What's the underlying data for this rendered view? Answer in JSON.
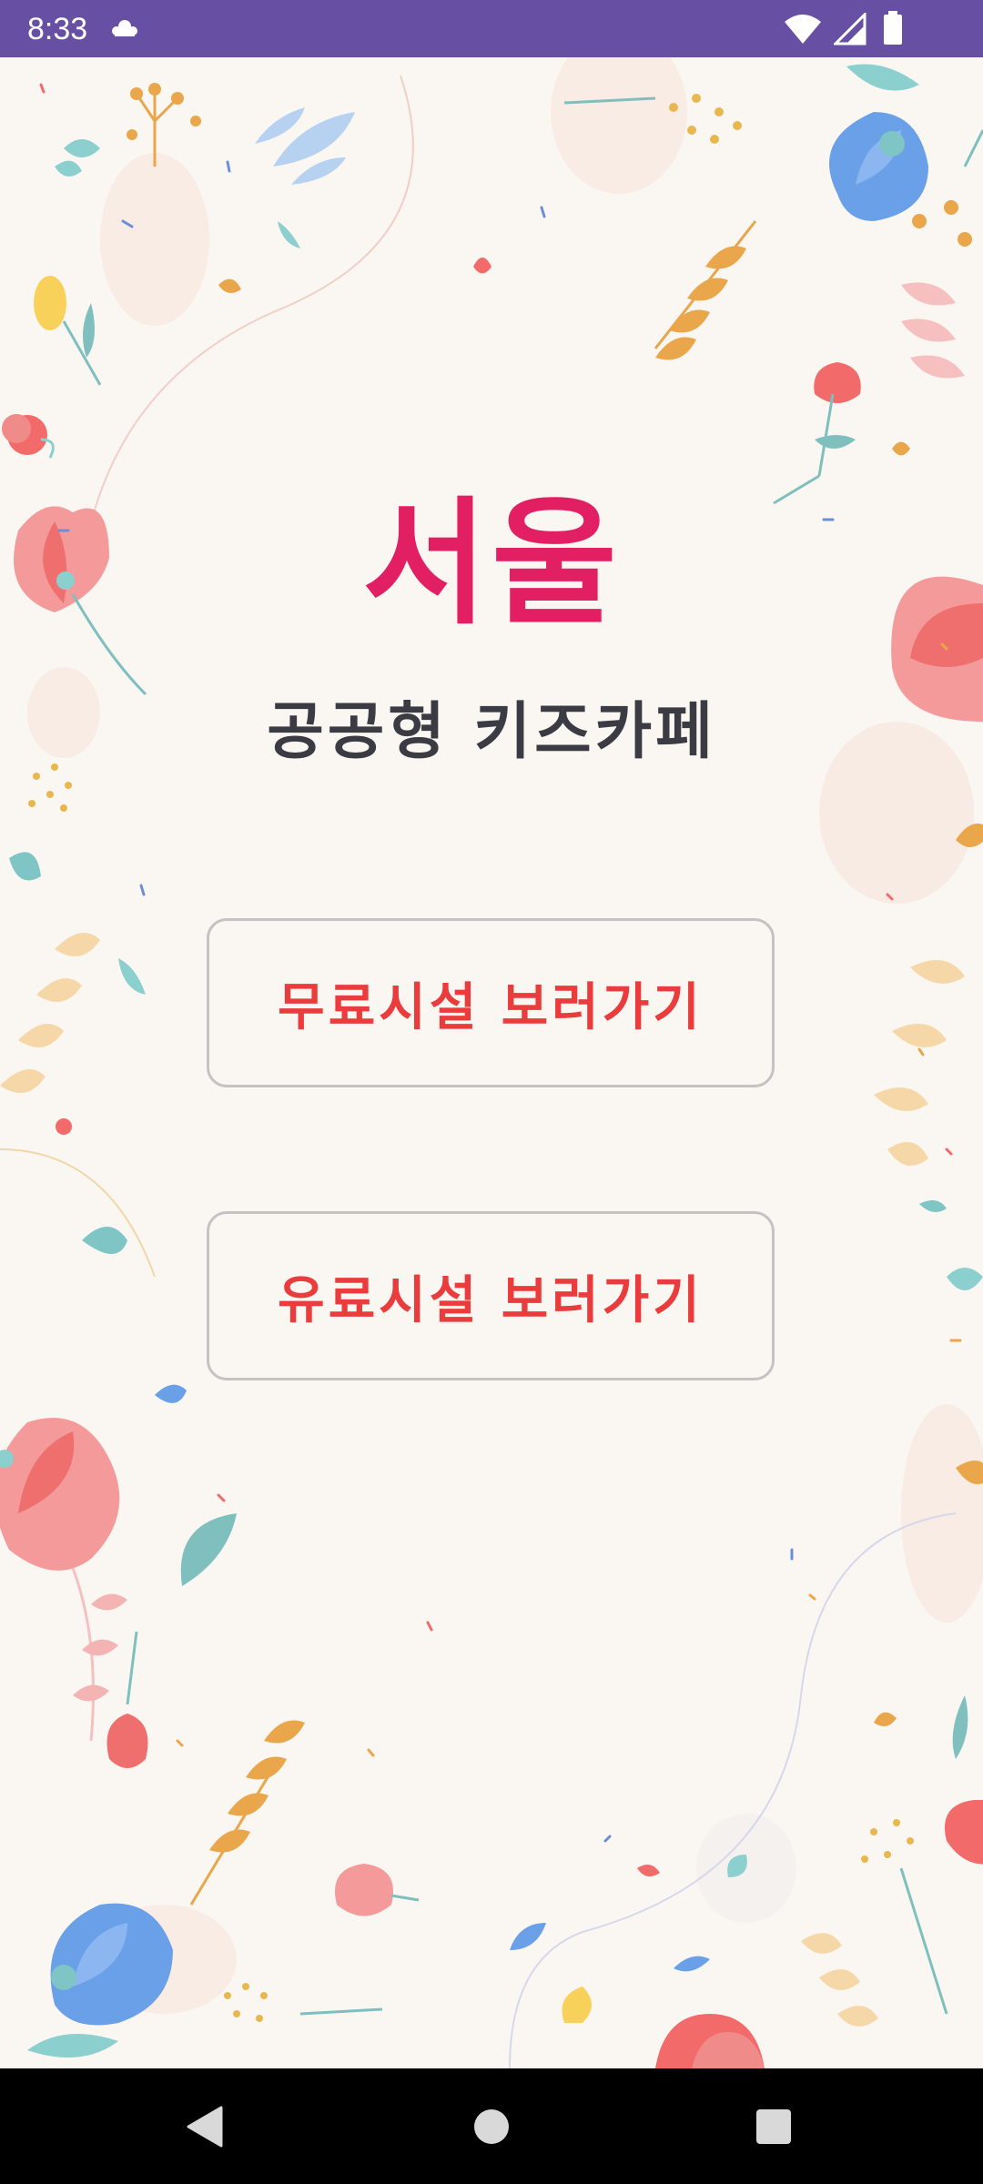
{
  "status_bar": {
    "time": "8:33",
    "notification_icon": "cloud-notification-icon",
    "wifi_icon": "wifi-icon",
    "signal_icon": "cell-signal-icon",
    "battery_icon": "battery-icon",
    "color": "#6750a4"
  },
  "header": {
    "title": "서울",
    "subtitle": "공공형 키즈카페"
  },
  "buttons": {
    "free_facilities": "무료시설 보러가기",
    "paid_facilities": "유료시설 보러가기"
  },
  "nav_bar": {
    "back_icon": "back-triangle-icon",
    "home_icon": "home-circle-icon",
    "recents_icon": "recents-square-icon"
  },
  "colors": {
    "background": "#faf7f3",
    "title": "#e31f64",
    "subtitle": "#3b3b43",
    "button_text": "#ea3c3c",
    "button_border": "#c6c2c4"
  }
}
